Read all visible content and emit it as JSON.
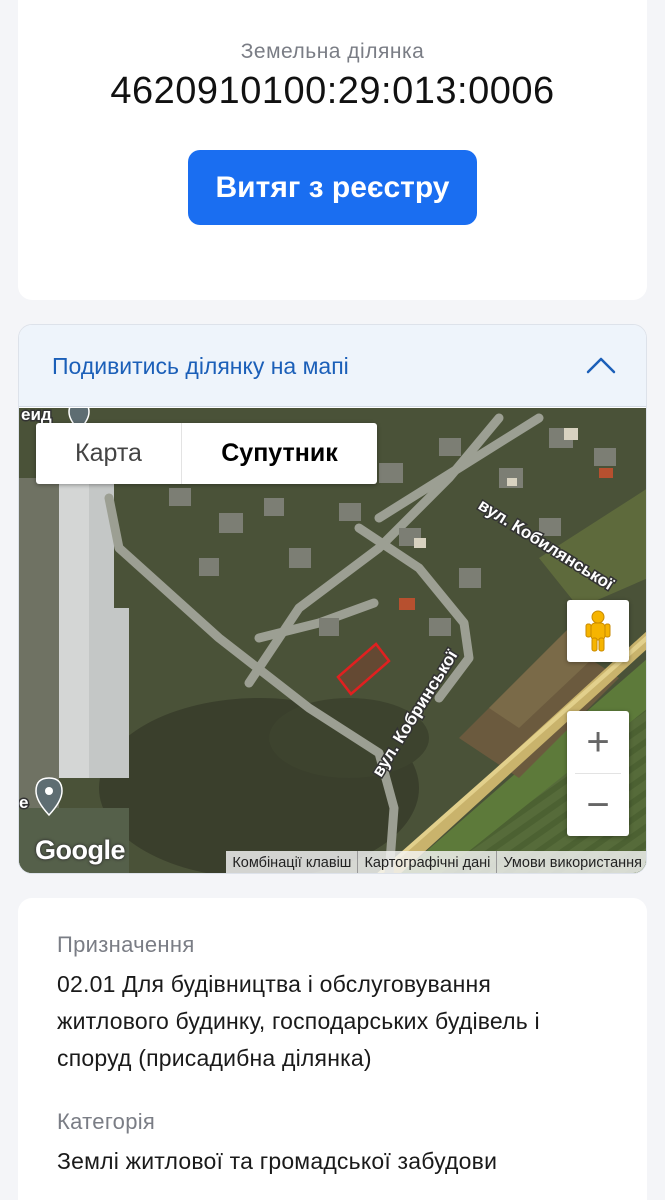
{
  "parcel": {
    "subtitle": "Земельна ділянка",
    "cadastral_number": "4620910100:29:013:0006",
    "extract_button": "Витяг з реєстру"
  },
  "map_section": {
    "header": "Подивитись ділянку на мапі",
    "toggle_icon": "chevron-up-icon",
    "map_type": {
      "map_label": "Карта",
      "satellite_label": "Супутник",
      "selected": "Супутник"
    },
    "street_labels": [
      "вул. Кобилянської",
      "вул. Кобринської"
    ],
    "partial_labels": [
      "еид",
      "е"
    ],
    "zoom_in": "+",
    "zoom_out": "−",
    "google_logo": "Google",
    "attribution": [
      "Комбінації клавіш",
      "Картографічні дані",
      "Умови використання"
    ],
    "colors": {
      "parcel_outline": "#e02020",
      "header_bg": "#eef4fb",
      "link": "#1b5fb8"
    }
  },
  "details": [
    {
      "label": "Призначення",
      "value_lines": [
        "02.01 Для будівництва і обслуговування",
        "житлового будинку, господарських будівель і",
        "споруд (присадибна ділянка)"
      ]
    },
    {
      "label": "Категорія",
      "value_lines": [
        "Землі житлової та громадської забудови"
      ]
    }
  ],
  "colors": {
    "accent": "#1a6ef1",
    "page_bg": "#f4f5f8"
  }
}
